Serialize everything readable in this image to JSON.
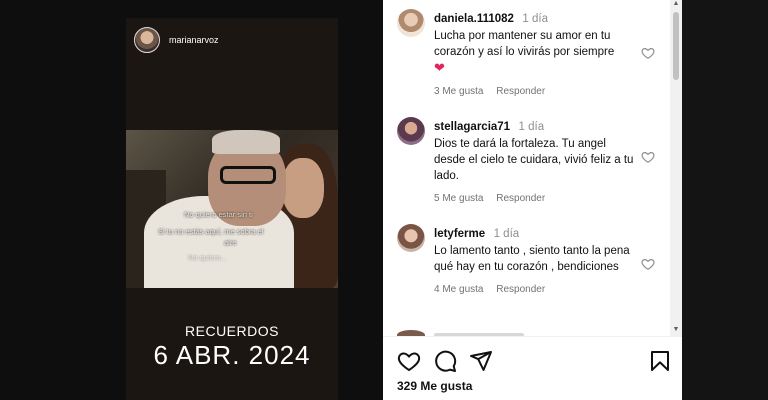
{
  "story": {
    "username": "marianarvoz",
    "overlay_lines": [
      "No quiero estar sin ti",
      "Si tu no estás aquí, me sobra el",
      "aire",
      "No quiero..."
    ],
    "caption_small": "RECUERDOS",
    "caption_big": "6 ABR. 2024"
  },
  "comments": [
    {
      "username": "daniela.111082",
      "time": "1 día",
      "text": "Lucha por mantener su amor en tu corazón y así lo vivirás por siempre",
      "emoji": "❤",
      "likes": "3 Me gusta",
      "reply": "Responder",
      "avatar_color": "#d8c0a8"
    },
    {
      "username": "stellagarcia71",
      "time": "1 día",
      "text": "Dios te dará la fortaleza. Tu angel desde el cielo te cuidara, vivió feliz a tu lado.",
      "likes": "5 Me gusta",
      "reply": "Responder",
      "avatar_color": "#6b4a5c"
    },
    {
      "username": "letyferme",
      "time": "1 día",
      "text": "Lo lamento tanto , siento tanto la pena qué hay en tu corazón , bendiciones",
      "likes": "4 Me gusta",
      "reply": "Responder",
      "avatar_color": "#a98570"
    }
  ],
  "actions": {
    "like_icon": "heart-outline-icon",
    "comment_icon": "comment-bubble-icon",
    "share_icon": "paper-plane-icon",
    "save_icon": "bookmark-icon",
    "likes_count": "329 Me gusta"
  },
  "colors": {
    "panel_bg": "#ffffff",
    "story_bg": "#1c1612",
    "heart_red": "#e0245e",
    "meta_gray": "#737373"
  }
}
